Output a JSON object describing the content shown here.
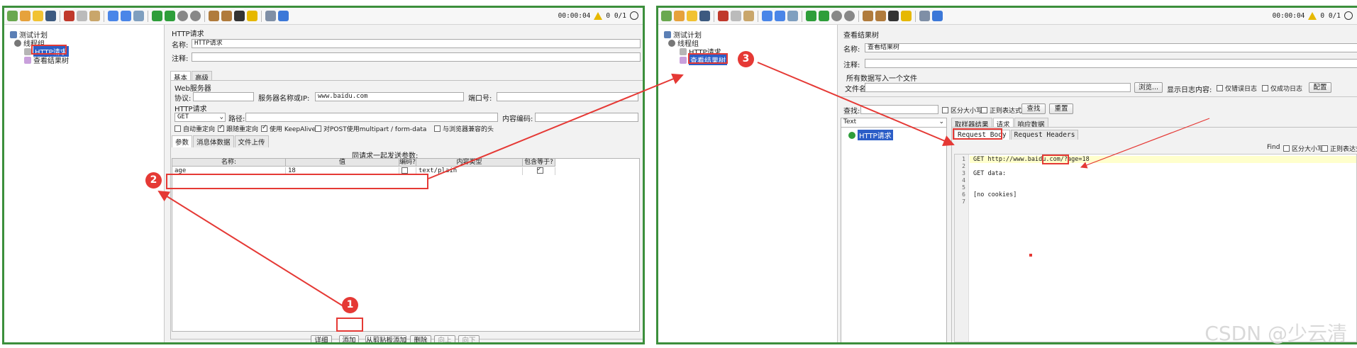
{
  "left": {
    "status_time": "00:00:04",
    "status_count": "0 0/1",
    "tree": {
      "test_plan": "测试计划",
      "thread_group": "线程组",
      "http_request": "HTTP请求",
      "result_tree": "查看结果树"
    },
    "panel_title": "HTTP请求",
    "name_label": "名称:",
    "name_value": "HTTP请求",
    "comment_label": "注释:",
    "tabs": [
      "基本",
      "高级"
    ],
    "web_server": "Web服务器",
    "protocol_label": "协议:",
    "server_label": "服务器名称或IP:",
    "server_value": "www.baidu.com",
    "port_label": "端口号:",
    "http_request_section": "HTTP请求",
    "method_value": "GET",
    "path_label": "路径:",
    "encoding_label": "内容编码:",
    "options": [
      {
        "label": "自动重定向",
        "checked": false
      },
      {
        "label": "跟随重定向",
        "checked": true
      },
      {
        "label": "使用 KeepAlive",
        "checked": true
      },
      {
        "label": "对POST使用multipart / form-data",
        "checked": false
      },
      {
        "label": "与浏览器兼容的头",
        "checked": false
      }
    ],
    "param_tabs": [
      "参数",
      "消息体数据",
      "文件上传"
    ],
    "send_with_request": "同请求一起发送参数:",
    "table_headers": [
      "名称:",
      "值",
      "编码?",
      "内容类型",
      "包含等于?"
    ],
    "param_row": {
      "name": "age",
      "value": "18",
      "encode": false,
      "content_type": "text/plain",
      "include_equals": true
    },
    "buttons": {
      "detail": "详细",
      "add": "添加",
      "add_clipboard": "从剪贴板添加",
      "delete": "删除",
      "up": "向上",
      "down": "向下"
    }
  },
  "right": {
    "status_time": "00:00:04",
    "status_count": "0 0/1",
    "tree": {
      "test_plan": "测试计划",
      "thread_group": "线程组",
      "http_request": "HTTP请求",
      "result_tree": "查看结果树"
    },
    "panel_title": "查看结果树",
    "name_label": "名称:",
    "name_value": "查看结果树",
    "comment_label": "注释:",
    "write_all": "所有数据写入一个文件",
    "filename_label": "文件名",
    "browse_button": "浏览...",
    "log_display_label": "显示日志内容:",
    "errors_only": "仅错误日志",
    "success_only": "仅成功日志",
    "configure_button": "配置",
    "search_label": "查找:",
    "case_sensitive": "区分大小写",
    "regex": "正则表达式",
    "search_button": "查找",
    "reset_button": "重置",
    "renderer_value": "Text",
    "result_item": "HTTP请求",
    "result_tabs": [
      "取样器结果",
      "请求",
      "响应数据"
    ],
    "request_subtabs": [
      "Request Body",
      "Request Headers"
    ],
    "find_label": "Find",
    "code_lines": [
      {
        "n": "1",
        "text": "GET http://www.baidu.com/?age=18"
      },
      {
        "n": "2",
        "text": ""
      },
      {
        "n": "3",
        "text": "GET data:"
      },
      {
        "n": "4",
        "text": ""
      },
      {
        "n": "5",
        "text": ""
      },
      {
        "n": "6",
        "text": "[no cookies]"
      },
      {
        "n": "7",
        "text": ""
      }
    ]
  },
  "badges": [
    "1",
    "2",
    "3"
  ],
  "watermark": "CSDN @少云清",
  "colors": {
    "frame_green": "#3c8f3c",
    "annotation_red": "#e53935",
    "selection_blue": "#2c5ec7"
  }
}
